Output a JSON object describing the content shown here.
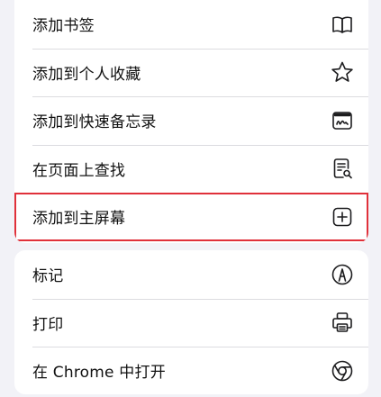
{
  "menu_top": {
    "items": [
      {
        "label": "添加书签",
        "icon": "book-icon"
      },
      {
        "label": "添加到个人收藏",
        "icon": "star-icon"
      },
      {
        "label": "添加到快速备忘录",
        "icon": "quick-note-icon"
      },
      {
        "label": "在页面上查找",
        "icon": "find-in-page-icon"
      },
      {
        "label": "添加到主屏幕",
        "icon": "plus-square-icon"
      }
    ]
  },
  "menu_bottom": {
    "items": [
      {
        "label": "标记",
        "icon": "markup-icon"
      },
      {
        "label": "打印",
        "icon": "printer-icon"
      },
      {
        "label": "在 Chrome 中打开",
        "icon": "chrome-icon"
      }
    ]
  },
  "colors": {
    "background": "#f2f2f7",
    "card": "#ffffff",
    "highlight_border": "#e0303a",
    "text": "#111111"
  }
}
